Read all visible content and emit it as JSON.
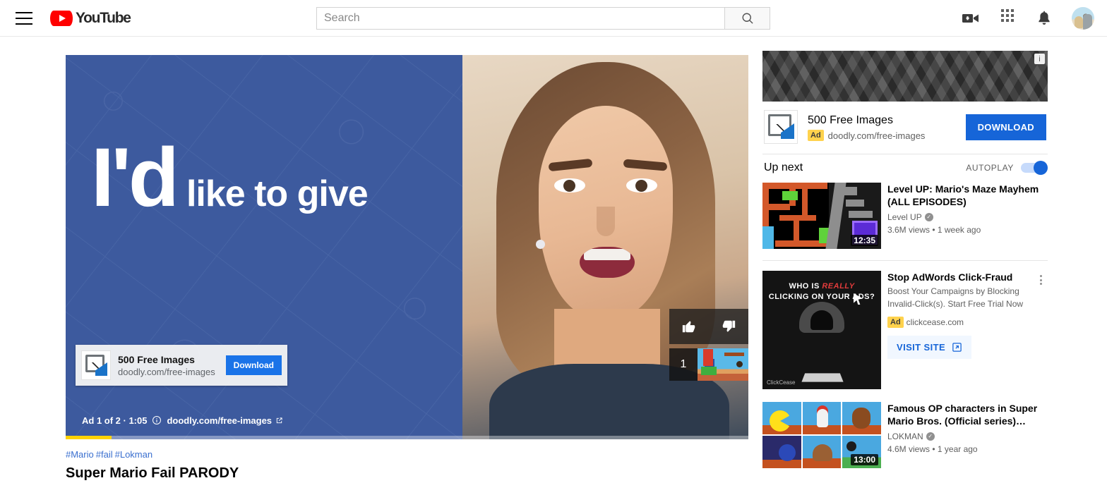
{
  "header": {
    "menu_icon": "hamburger-icon",
    "logo_text": "YouTube",
    "search": {
      "value": "",
      "placeholder": "Search"
    },
    "search_icon": "search-icon",
    "create_icon": "video-camera-plus-icon",
    "apps_icon": "apps-grid-icon",
    "notifications_icon": "bell-icon",
    "avatar_icon": "user-avatar"
  },
  "player": {
    "ad_headline_big": "I'd",
    "ad_headline_small": "like to give",
    "overlay_ad": {
      "title": "500 Free Images",
      "url": "doodly.com/free-images",
      "button": "Download",
      "icon": "chart-image-icon"
    },
    "reactions": {
      "like_icon": "thumbs-up-icon",
      "dislike_icon": "thumbs-down-icon"
    },
    "upnext_preview": {
      "count": "1",
      "thumb_icon": "mario-game-thumbnail"
    },
    "info_bar": {
      "ad_counter": "Ad 1 of 2 · 1:05",
      "info_icon": "info-circle-icon",
      "url": "doodly.com/free-images",
      "external_icon": "external-link-icon"
    },
    "progress_percent": 6.7,
    "progress_color": "#ffd200",
    "ad_background_color": "#3d5a9e"
  },
  "video": {
    "hashtags": [
      "#Mario",
      "#fail",
      "#Lokman"
    ],
    "title": "Super Mario Fail PARODY"
  },
  "sidebar": {
    "promo_banner": {
      "name": "promo-banner",
      "info_icon": "info-circle-icon"
    },
    "ad": {
      "title": "500 Free Images",
      "badge": "Ad",
      "url": "doodly.com/free-images",
      "button": "DOWNLOAD",
      "icon": "chart-image-icon",
      "button_color": "#1665d8"
    },
    "upnext": {
      "title": "Up next",
      "autoplay_label": "AUTOPLAY",
      "autoplay_on": true,
      "toggle_color": "#1665d8"
    },
    "items": [
      {
        "kind": "video",
        "title": "Level UP: Mario's Maze Mayhem (ALL EPISODES)",
        "channel": "Level UP",
        "verified": true,
        "stats": "3.6M views • 1 week ago",
        "duration": "12:35",
        "thumb": "mario-maze-thumbnail"
      },
      {
        "kind": "ad",
        "title": "Stop AdWords Click-Fraud",
        "description": "Boost Your Campaigns by Blocking Invalid-Click(s). Start Free Trial Now",
        "badge": "Ad",
        "url": "clickcease.com",
        "cta": "VISIT SITE",
        "cta_icon": "external-link-icon",
        "menu_icon": "kebab-menu-icon",
        "thumb": "clickcease-ad-thumbnail",
        "thumb_line1_a": "WHO IS ",
        "thumb_line1_b": "REALLY",
        "thumb_line2": "CLICKING ON YOUR ADS?",
        "thumb_logo": "ClickCease"
      },
      {
        "kind": "video",
        "title": "Famous OP characters in Super Mario Bros. (Official series)…",
        "channel": "LOKMAN",
        "verified": true,
        "stats": "4.6M views • 1 year ago",
        "duration": "13:00",
        "thumb": "mario-characters-grid-thumbnail"
      }
    ]
  }
}
